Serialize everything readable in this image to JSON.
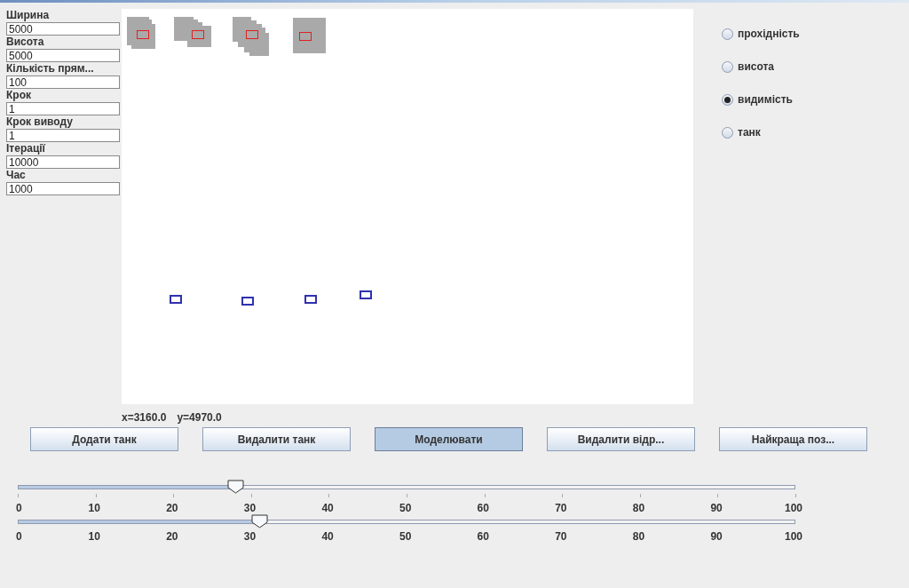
{
  "fields": [
    {
      "label": "Ширина",
      "value": "5000"
    },
    {
      "label": "Висота",
      "value": "5000"
    },
    {
      "label": "Кількість прям...",
      "value": "100"
    },
    {
      "label": "Крок",
      "value": "1"
    },
    {
      "label": "Крок виводу",
      "value": "1"
    },
    {
      "label": "Ітерації",
      "value": "10000"
    },
    {
      "label": "Час",
      "value": "1000"
    }
  ],
  "radios": [
    {
      "label": "прохідність",
      "selected": false
    },
    {
      "label": "висота",
      "selected": false
    },
    {
      "label": "видимість",
      "selected": true
    },
    {
      "label": "танк",
      "selected": false
    }
  ],
  "coordinates": [
    "x=3160.0",
    "y=4970.0"
  ],
  "buttons": [
    {
      "label": "Додати танк",
      "pressed": false
    },
    {
      "label": "Видалити танк",
      "pressed": false
    },
    {
      "label": "Моделювати",
      "pressed": true
    },
    {
      "label": "Видалити відр...",
      "pressed": false
    },
    {
      "label": "Найкраща поз...",
      "pressed": false
    }
  ],
  "sliders": [
    {
      "level": 0.28,
      "tick_marks": true,
      "ticks": [
        "0",
        "10",
        "20",
        "30",
        "40",
        "50",
        "60",
        "70",
        "80",
        "90",
        "100"
      ]
    },
    {
      "level": 0.31,
      "tick_marks": false,
      "ticks": [
        "0",
        "10",
        "20",
        "30",
        "40",
        "50",
        "60",
        "70",
        "80",
        "90",
        "100"
      ]
    }
  ]
}
